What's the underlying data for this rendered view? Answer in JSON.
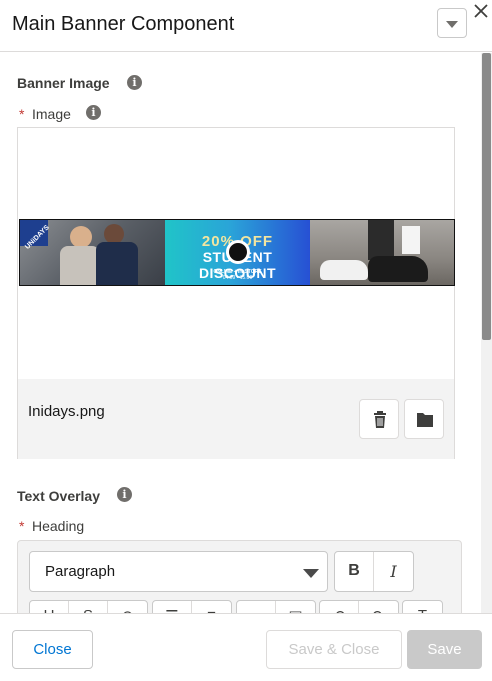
{
  "header": {
    "title": "Main Banner Component"
  },
  "banner_image_section": {
    "title": "Banner Image",
    "image_field": {
      "required_marker": "*",
      "label": "Image",
      "preview": {
        "tag_text": "UNiDAYS",
        "headline": "20% OFF",
        "subheadline": "STUDENT DISCOUNT",
        "line3": "ONLINE + IN STORE",
        "line4": "04.09 - 15.09"
      },
      "file_name": "Inidays.png"
    }
  },
  "text_overlay_section": {
    "title": "Text Overlay",
    "heading_field": {
      "required_marker": "*",
      "label": "Heading",
      "format_select_value": "Paragraph",
      "bold_label": "B",
      "italic_label": "I"
    }
  },
  "footer": {
    "close_label": "Close",
    "save_close_label": "Save & Close",
    "save_label": "Save"
  }
}
